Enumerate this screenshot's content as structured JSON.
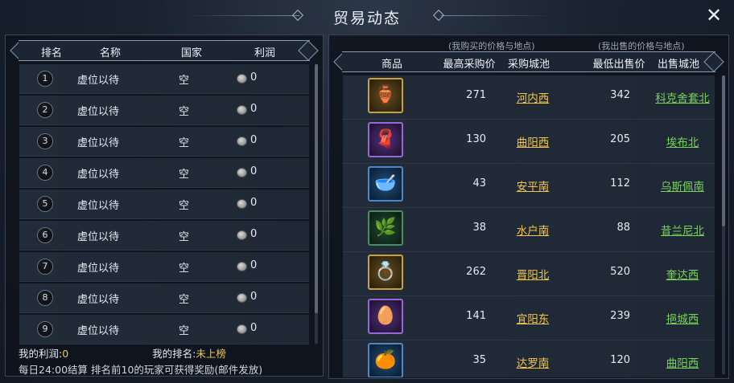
{
  "window": {
    "title": "贸易动态",
    "close_icon": "✕"
  },
  "left": {
    "headers": {
      "rank": "排名",
      "name": "名称",
      "country": "国家",
      "profit": "利润"
    },
    "rows": [
      {
        "rank": "1",
        "name": "虚位以待",
        "country": "空",
        "profit": "0"
      },
      {
        "rank": "2",
        "name": "虚位以待",
        "country": "空",
        "profit": "0"
      },
      {
        "rank": "3",
        "name": "虚位以待",
        "country": "空",
        "profit": "0"
      },
      {
        "rank": "4",
        "name": "虚位以待",
        "country": "空",
        "profit": "0"
      },
      {
        "rank": "5",
        "name": "虚位以待",
        "country": "空",
        "profit": "0"
      },
      {
        "rank": "6",
        "name": "虚位以待",
        "country": "空",
        "profit": "0"
      },
      {
        "rank": "7",
        "name": "虚位以待",
        "country": "空",
        "profit": "0"
      },
      {
        "rank": "8",
        "name": "虚位以待",
        "country": "空",
        "profit": "0"
      },
      {
        "rank": "9",
        "name": "虚位以待",
        "country": "空",
        "profit": "0"
      }
    ],
    "my_profit_label": "我的利润:",
    "my_profit_value": "0",
    "my_rank_label": "我的排名:",
    "my_rank_value": "未上榜",
    "note": "每日24:00结算 排名前10的玩家可获得奖励(邮件发放)"
  },
  "right": {
    "sub_buy": "(我购买的价格与地点)",
    "sub_sell": "(我出售的价格与地点)",
    "headers": {
      "goods": "商品",
      "max_buy": "最高采购价",
      "buy_city": "采购城池",
      "min_sell": "最低出售价",
      "sell_city": "出售城池"
    },
    "items": [
      {
        "icon": "vase-icon",
        "quality": "gold",
        "glyph": "🏺",
        "buy_price": "271",
        "buy_city": "河内西",
        "sell_price": "342",
        "sell_city": "科克舍套北"
      },
      {
        "icon": "silk-icon",
        "quality": "purple",
        "glyph": "🧣",
        "buy_price": "130",
        "buy_city": "曲阳西",
        "sell_price": "205",
        "sell_city": "埃布北"
      },
      {
        "icon": "spice-bowl-icon",
        "quality": "blue",
        "glyph": "🥣",
        "buy_price": "43",
        "buy_city": "安平南",
        "sell_price": "112",
        "sell_city": "乌斯佩南"
      },
      {
        "icon": "cotton-icon",
        "quality": "green",
        "glyph": "🌿",
        "buy_price": "38",
        "buy_city": "水户南",
        "sell_price": "88",
        "sell_city": "昔兰尼北"
      },
      {
        "icon": "gem-ring-icon",
        "quality": "gold",
        "glyph": "💍",
        "buy_price": "262",
        "buy_city": "晋阳北",
        "sell_price": "520",
        "sell_city": "奎达西"
      },
      {
        "icon": "egg-icon",
        "quality": "purple",
        "glyph": "🥚",
        "buy_price": "141",
        "buy_city": "宜阳东",
        "sell_price": "239",
        "sell_city": "挹城西"
      },
      {
        "icon": "fruit-basket-icon",
        "quality": "blue",
        "glyph": "🍊",
        "buy_price": "35",
        "buy_city": "达罗南",
        "sell_price": "120",
        "sell_city": "曲阳西"
      }
    ]
  }
}
